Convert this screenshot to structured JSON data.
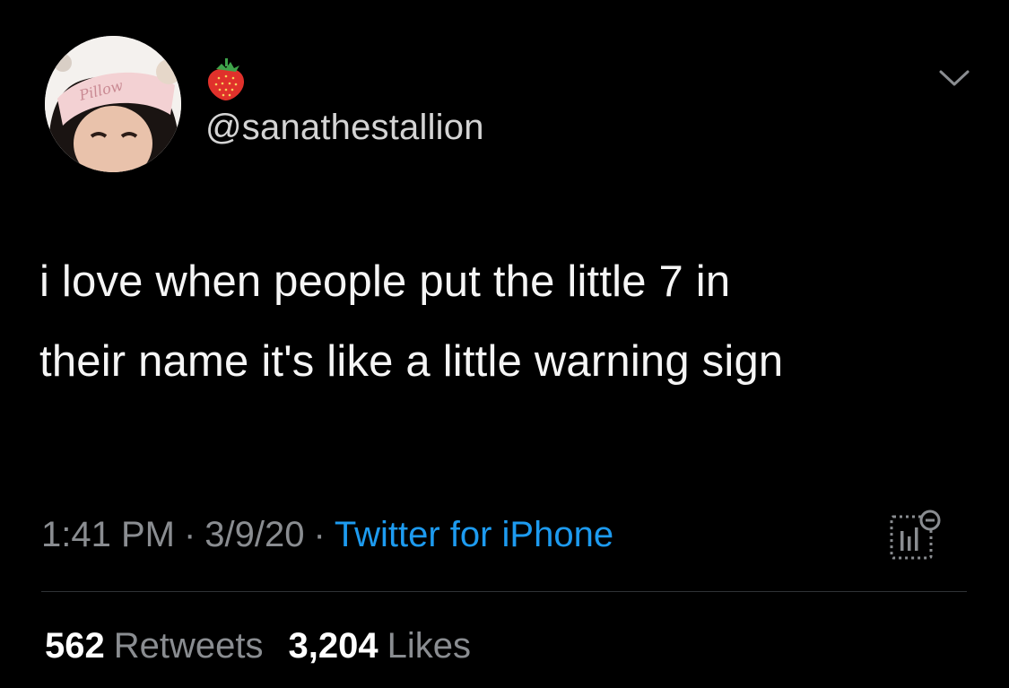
{
  "author": {
    "handle": "@sanathestallion",
    "display_name_icon": "strawberry-icon",
    "avatar_headband_text": "Pillow"
  },
  "tweet": {
    "text": "i love when people put the little 7 in\ntheir name it's like a little warning sign"
  },
  "meta": {
    "time": "1:41 PM",
    "date": "3/9/20",
    "separator": "·",
    "source": "Twitter for iPhone",
    "source_color": "#1d9bf0"
  },
  "stats": {
    "retweets_count": "562",
    "retweets_label": "Retweets",
    "likes_count": "3,204",
    "likes_label": "Likes"
  },
  "icons": {
    "menu": "chevron-down-icon",
    "analytics": "analytics-icon"
  },
  "colors": {
    "background": "#000000",
    "text": "#f5f5f5",
    "muted": "#8a8d91",
    "link": "#1d9bf0",
    "divider": "#2f3336"
  }
}
